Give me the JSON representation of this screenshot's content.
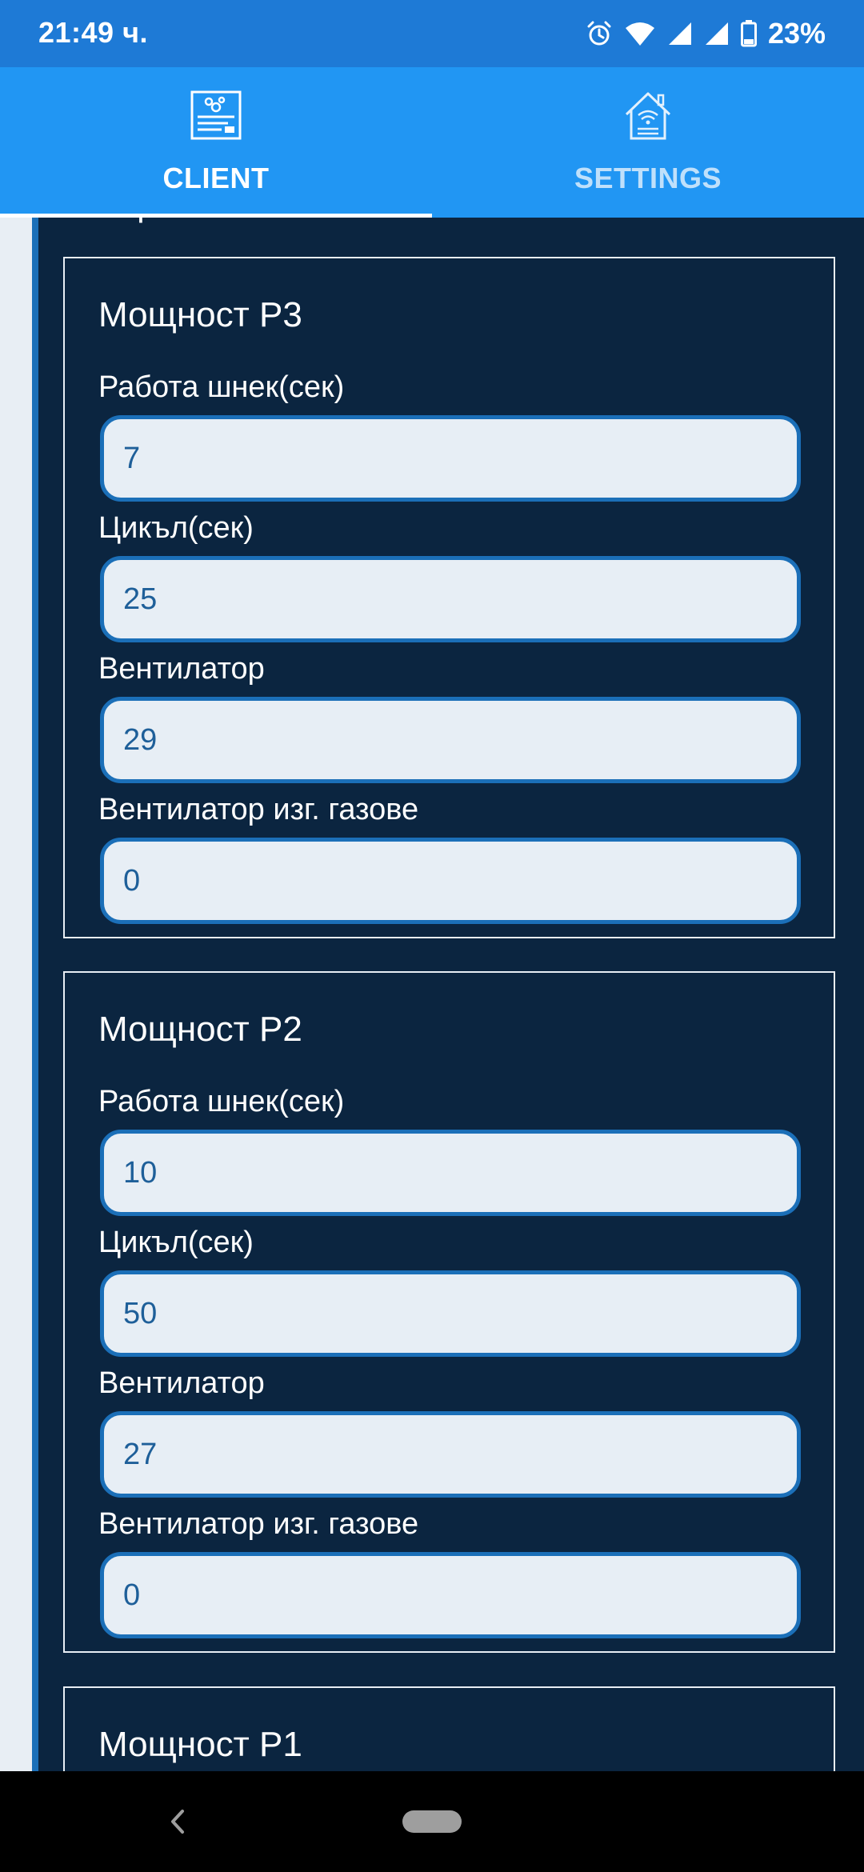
{
  "status_bar": {
    "time": "21:49 ч.",
    "battery_percent": "23%",
    "icons": [
      "alarm-icon",
      "wifi-icon",
      "signal-icon",
      "signal-icon",
      "battery-icon"
    ]
  },
  "tabs": [
    {
      "label": "CLIENT",
      "icon": "control-panel-icon",
      "active": true
    },
    {
      "label": "SETTINGS",
      "icon": "smart-home-icon",
      "active": false
    }
  ],
  "section_title_clipped": "Горене",
  "groups": [
    {
      "title": "Мощност P3",
      "fields": [
        {
          "label": "Работа шнек(сек)",
          "value": "7"
        },
        {
          "label": "Цикъл(сек)",
          "value": "25"
        },
        {
          "label": "Вентилатор",
          "value": "29"
        },
        {
          "label": "Вентилатор изг. газове",
          "value": "0"
        }
      ]
    },
    {
      "title": "Мощност P2",
      "fields": [
        {
          "label": "Работа шнек(сек)",
          "value": "10"
        },
        {
          "label": "Цикъл(сек)",
          "value": "50"
        },
        {
          "label": "Вентилатор",
          "value": "27"
        },
        {
          "label": "Вентилатор изг. газове",
          "value": "0"
        }
      ]
    },
    {
      "title": "Мощност P1"
    }
  ],
  "colors": {
    "status_bar": "#1e7ad6",
    "tab_bar": "#2196f3",
    "panel": "#0b2540",
    "input_border": "#1b6fb8",
    "input_bg": "#e7eef5",
    "input_text": "#1e5f99"
  }
}
